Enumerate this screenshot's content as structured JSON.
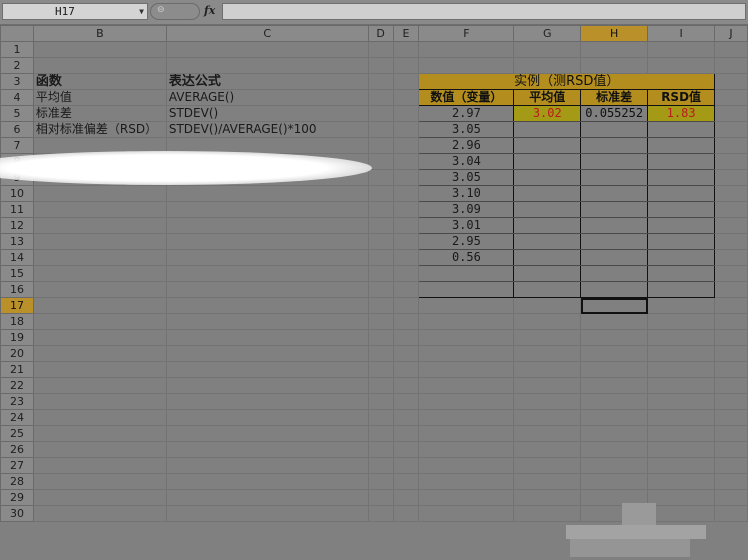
{
  "formula_bar": {
    "name_box": "H17",
    "fx_label": "fx",
    "formula": ""
  },
  "columns": [
    "",
    "B",
    "C",
    "D",
    "E",
    "F",
    "G",
    "H",
    "I",
    "J"
  ],
  "rows": [
    "1",
    "2",
    "3",
    "4",
    "5",
    "6",
    "7",
    "8",
    "9",
    "10",
    "11",
    "12",
    "13",
    "14",
    "15",
    "16",
    "17",
    "18",
    "19",
    "20",
    "21",
    "22",
    "23",
    "24",
    "25",
    "26",
    "27",
    "28",
    "29",
    "30"
  ],
  "left_table": {
    "header_func": "函数",
    "header_formula": "表达公式",
    "rows": [
      {
        "func": "平均值",
        "formula": "AVERAGE()"
      },
      {
        "func": "标准差",
        "formula": "STDEV()"
      },
      {
        "func": "相对标准偏差（RSD）",
        "formula": "STDEV()/AVERAGE()*100"
      }
    ]
  },
  "rsd_table": {
    "title": "实例（测RSD值）",
    "headers": [
      "数值（变量）",
      "平均值",
      "标准差",
      "RSD值"
    ],
    "values": [
      "2.97",
      "3.05",
      "2.96",
      "3.04",
      "3.05",
      "3.10",
      "3.09",
      "3.01",
      "2.95",
      "0.56"
    ],
    "average": "3.02",
    "stdev": "0.055252",
    "rsd": "1.83"
  },
  "colors": {
    "accent": "#b38e1f",
    "selection": "#b9902a",
    "result_fill": "#a49a16",
    "result_text": "#b81c1c"
  }
}
